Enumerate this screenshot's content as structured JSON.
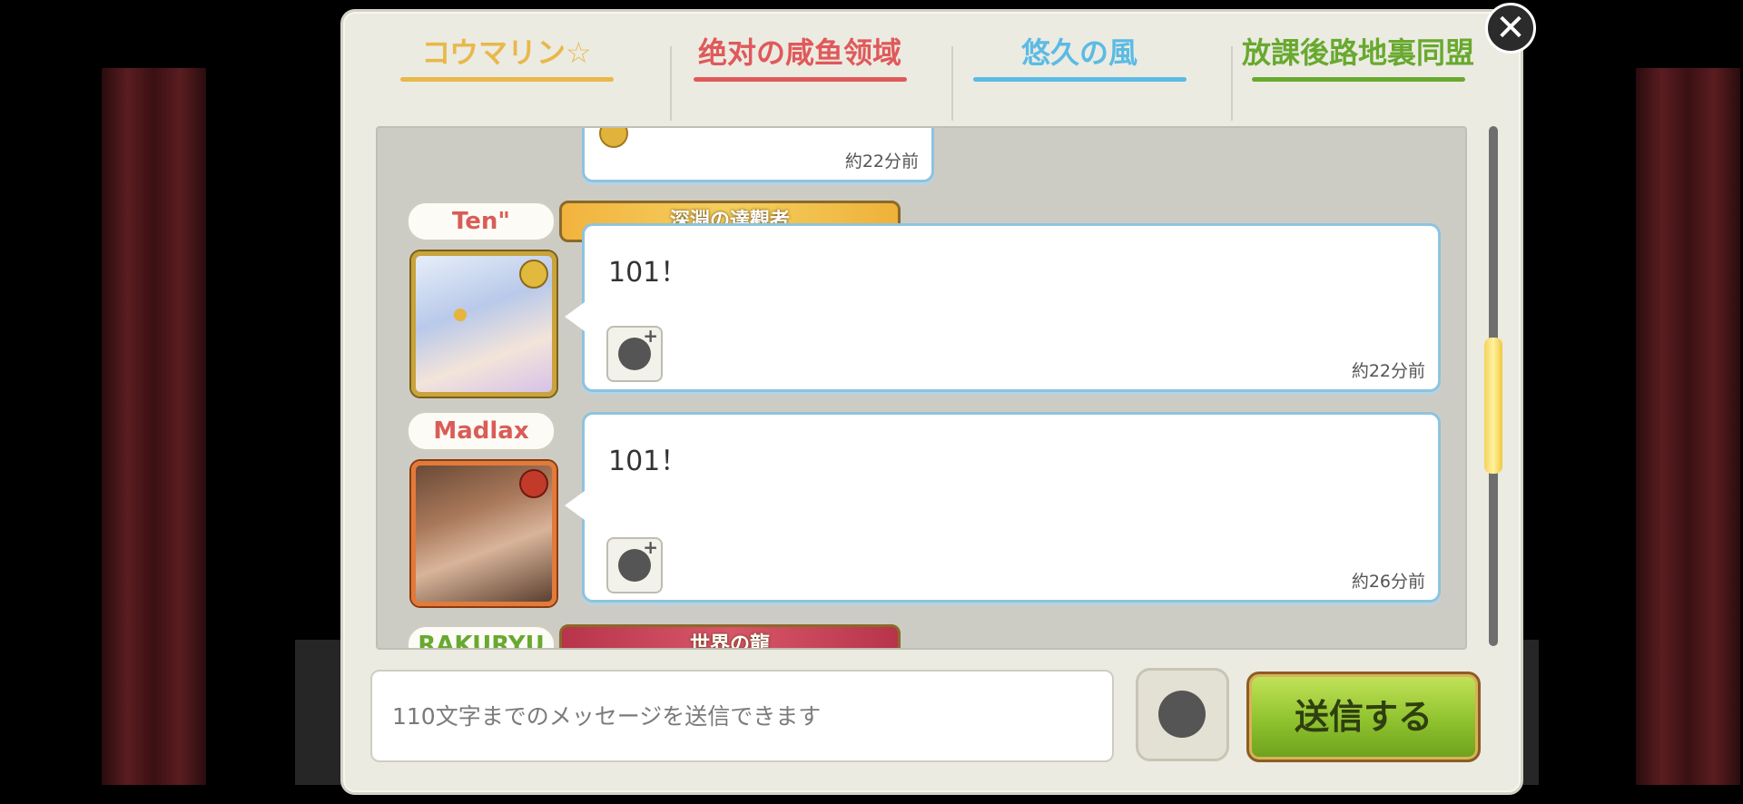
{
  "tabs": [
    {
      "label": "コウマリン☆",
      "color": "#e8b84a"
    },
    {
      "label": "绝对の咸鱼领域",
      "color": "#e0595a"
    },
    {
      "label": "悠久の風",
      "color": "#5bbbe4"
    },
    {
      "label": "放課後路地裏同盟",
      "color": "#68a92f"
    }
  ],
  "messages": [
    {
      "time": "約22分前"
    },
    {
      "sender": "Ten\"",
      "title": "深淵の達觀者",
      "text": "101！",
      "time": "約22分前",
      "avatar_icon": "anime-character-avatar-icon"
    },
    {
      "sender": "Madlax",
      "text": "101！",
      "time": "約26分前",
      "avatar_icon": "anime-character-avatar-icon"
    },
    {
      "sender": "RAKURYU",
      "title": "世界の龍"
    }
  ],
  "input": {
    "placeholder": "110文字までのメッセージを送信できます"
  },
  "send_button": {
    "label": "送信する"
  },
  "close_button": {
    "label": "✕"
  },
  "scroll_progress": 0.55
}
